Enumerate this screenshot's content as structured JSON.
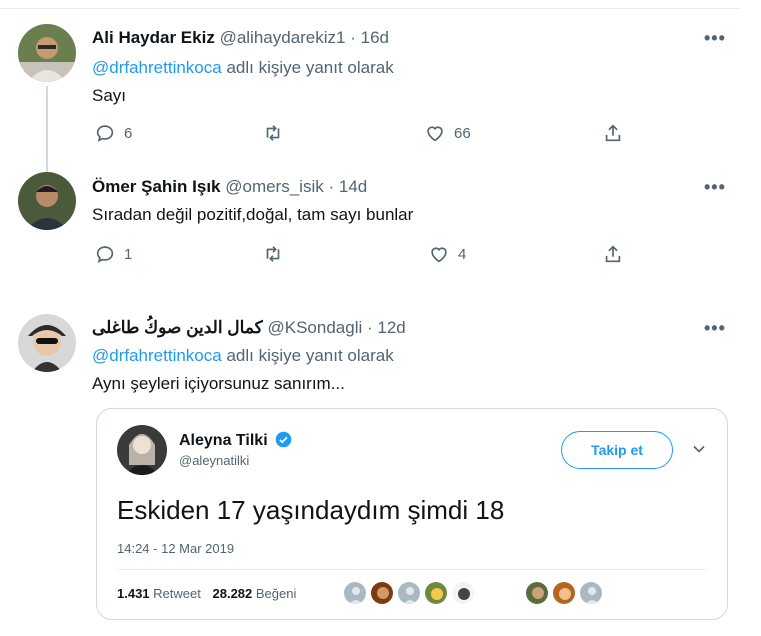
{
  "tweets": [
    {
      "name": "Ali Haydar Ekiz",
      "handle": "@alihaydarekiz1",
      "time": "16d",
      "reply_to_mention": "@drfahrettinkoca",
      "reply_to_suffix": "adlı kişiye yanıt olarak",
      "text": "Sayı",
      "reply_count": "6",
      "retweet_count": "",
      "like_count": "66"
    },
    {
      "name": "Ömer Şahin Işık",
      "handle": "@omers_isik",
      "time": "14d",
      "text": "Sıradan değil pozitif,doğal, tam sayı bunlar",
      "reply_count": "1",
      "retweet_count": "",
      "like_count": "4"
    },
    {
      "name": "كمال الدين صوكُ طاغلى",
      "handle": "@KSondagli",
      "time": "12d",
      "reply_to_mention": "@drfahrettinkoca",
      "reply_to_suffix": "adlı kişiye yanıt olarak",
      "text": "Aynı şeyleri içiyorsunuz sanırım..."
    }
  ],
  "embedded": {
    "name": "Aleyna Tilki",
    "handle": "@aleynatilki",
    "follow_label": "Takip et",
    "text": "Eskiden 17 yaşındaydım şimdi 18",
    "date": "14:24 - 12 Mar 2019",
    "retweets": "1.431",
    "retweets_label": "Retweet",
    "likes": "28.282",
    "likes_label": "Beğeni"
  },
  "separator": "·",
  "more_glyph": "•••",
  "colors": {
    "accent": "#1d9bf0",
    "muted": "#536471",
    "border": "#cfd9de"
  }
}
